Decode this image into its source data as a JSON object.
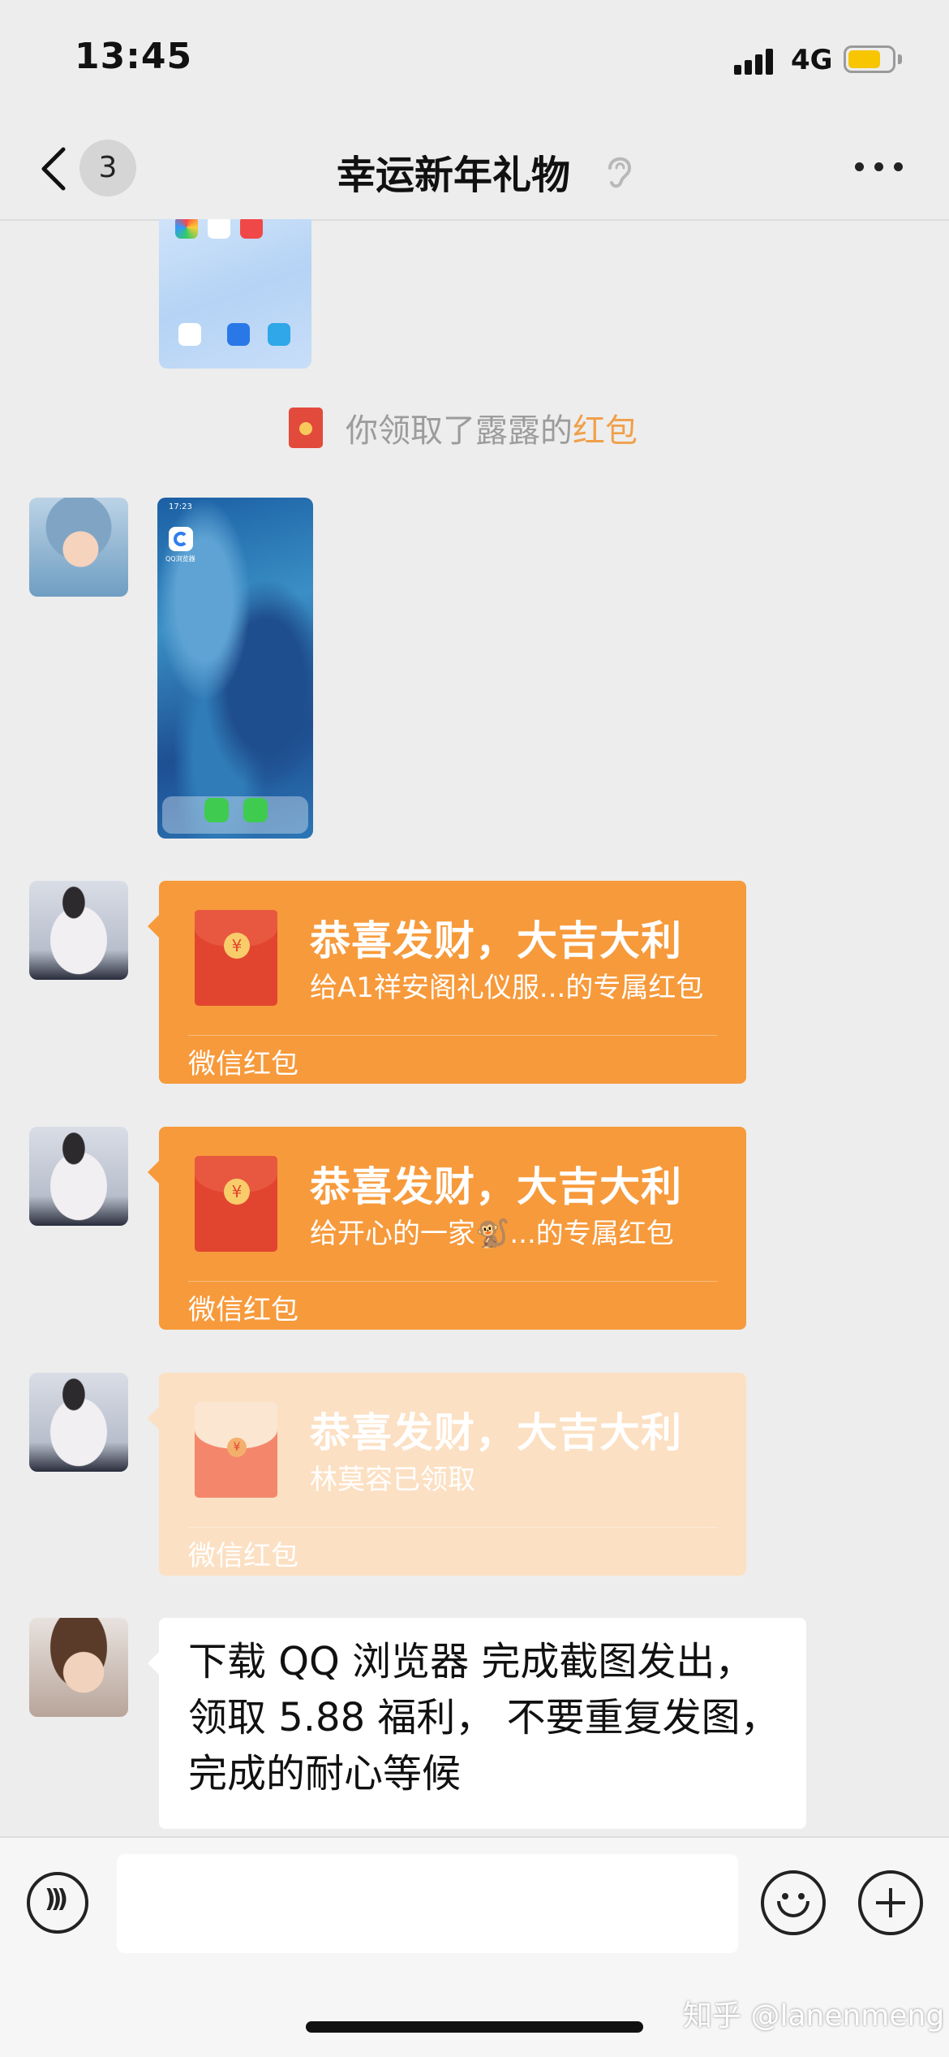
{
  "status_bar": {
    "time": "13:45",
    "network": "4G",
    "battery_level": 0.75
  },
  "nav": {
    "back_icon": "chevron-left-icon",
    "unread_count": "3",
    "title": "幸运新年礼物",
    "mute_icon": "ear-icon",
    "more_icon": "ellipsis-icon"
  },
  "system_message": {
    "prefix": "你领取了露露的",
    "link": "红包"
  },
  "screenshot_image": {
    "time": "17:23",
    "app_label": "QQ浏览器"
  },
  "red_packets": [
    {
      "title": "恭喜发财，大吉大利",
      "subtitle": "给A1祥安阁礼仪服...的专属红包",
      "footer": "微信红包",
      "opened": false
    },
    {
      "title": "恭喜发财，大吉大利",
      "subtitle": "给开心的一家🐒...的专属红包",
      "footer": "微信红包",
      "opened": false
    },
    {
      "title": "恭喜发财，大吉大利",
      "subtitle": "林莫容已领取",
      "footer": "微信红包",
      "opened": true
    }
  ],
  "text_message": {
    "lines": [
      "下载 QQ 浏览器 完成截图发出，",
      "领取 5.88 福利， 不要重复发图，",
      "完成的耐心等候"
    ]
  },
  "input_bar": {
    "voice_icon": "voice-icon",
    "message_value": "",
    "emoji_icon": "emoji-icon",
    "plus_icon": "plus-icon"
  },
  "watermark": "知乎 @lanenmeng",
  "colors": {
    "red_packet": "#f79a3b",
    "red_packet_opened": "#fce0c3",
    "link": "#f0a04a",
    "background": "#ededed"
  }
}
